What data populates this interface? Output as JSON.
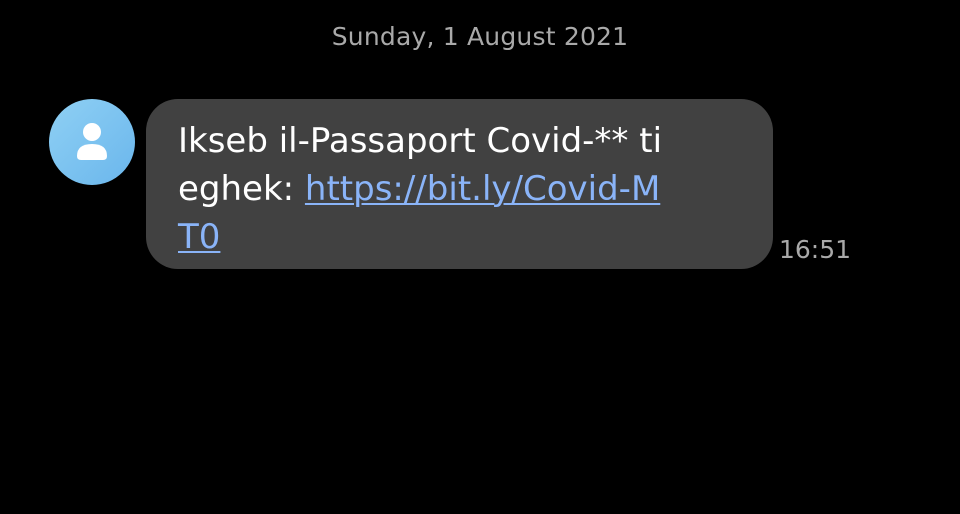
{
  "conversation": {
    "date_header": "Sunday, 1 August 2021",
    "message": {
      "sender_icon": "person-icon",
      "text_prefix": "Ikseb il-Passaport Covid-** tieghek: ",
      "link_text": "https://bit.ly/Covid-MT0",
      "time": "16:51"
    }
  },
  "colors": {
    "background": "#000000",
    "bubble": "#414141",
    "link": "#8ab4f8",
    "avatar": "#7cc3f0",
    "muted_text": "#a9a9a9"
  }
}
